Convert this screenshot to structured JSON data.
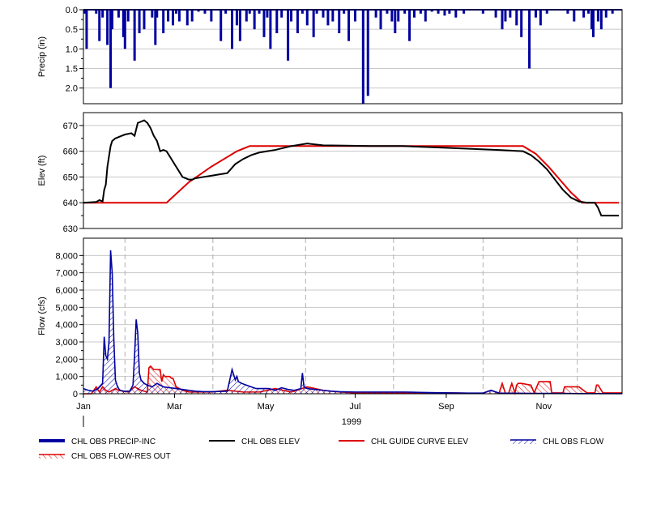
{
  "chart_data": [
    {
      "type": "bar",
      "panel": "precip",
      "ylabel": "Precip (in)",
      "ylim": [
        0,
        2.4
      ],
      "y_inverted": true,
      "yticks": [
        "0.0",
        "0.5",
        "1.0",
        "1.5",
        "2.0"
      ],
      "ytick_values": [
        0,
        0.5,
        1.0,
        1.5,
        2.0
      ],
      "grid": true,
      "series": [
        {
          "name": "CHL OBS PRECIP-INC",
          "color": "#0000a0",
          "x": [
            1,
            2,
            8,
            10,
            12,
            15,
            17,
            18,
            22,
            25,
            26,
            28,
            32,
            35,
            38,
            43,
            45,
            46,
            50,
            53,
            56,
            58,
            60,
            65,
            68,
            72,
            76,
            80,
            86,
            89,
            93,
            96,
            98,
            102,
            104,
            107,
            110,
            113,
            115,
            117,
            121,
            124,
            128,
            130,
            134,
            137,
            140,
            144,
            146,
            150,
            153,
            156,
            160,
            163,
            166,
            170,
            175,
            178,
            183,
            186,
            190,
            193,
            195,
            197,
            201,
            204,
            207,
            211,
            214,
            218,
            222,
            226,
            229,
            233,
            238,
            250,
            258,
            262,
            264,
            267,
            271,
            274,
            279,
            283,
            286,
            290,
            303,
            307,
            313,
            316,
            318,
            319,
            322,
            324,
            327,
            331
          ],
          "values": [
            0.1,
            1.0,
            0.1,
            0.8,
            0.2,
            0.9,
            2.0,
            0.5,
            0.2,
            0.7,
            1.0,
            0.3,
            1.3,
            0.6,
            0.5,
            0.2,
            0.9,
            0.2,
            0.6,
            0.3,
            0.4,
            0.1,
            0.3,
            0.4,
            0.3,
            0.05,
            0.1,
            0.3,
            0.8,
            0.1,
            1.0,
            0.4,
            0.8,
            0.3,
            0.1,
            0.5,
            0.1,
            0.7,
            0.2,
            1.0,
            0.6,
            0.2,
            1.3,
            0.3,
            0.6,
            0.1,
            0.4,
            0.7,
            0.1,
            0.2,
            0.4,
            0.3,
            0.6,
            0.1,
            0.8,
            0.3,
            2.4,
            2.2,
            0.2,
            0.5,
            0.1,
            0.3,
            0.6,
            0.3,
            0.1,
            0.8,
            0.2,
            0.1,
            0.3,
            0.05,
            0.1,
            0.15,
            0.1,
            0.2,
            0.1,
            0.1,
            0.2,
            0.5,
            0.3,
            0.2,
            0.4,
            0.7,
            1.5,
            0.2,
            0.4,
            0.1,
            0.1,
            0.3,
            0.2,
            0.1,
            0.5,
            0.7,
            0.3,
            0.5,
            0.2,
            0.1
          ]
        }
      ]
    },
    {
      "type": "line",
      "panel": "elevation",
      "ylabel": "Elev (ft)",
      "ylim": [
        630,
        675
      ],
      "yticks": [
        "630",
        "640",
        "650",
        "660",
        "670"
      ],
      "ytick_values": [
        630,
        640,
        650,
        660,
        670
      ],
      "grid": true,
      "series": [
        {
          "name": "CHL OBS ELEV",
          "color": "#000000",
          "x": [
            0,
            8,
            10,
            12,
            13,
            14,
            15,
            16,
            17,
            18,
            19,
            20,
            22,
            24,
            26,
            30,
            32,
            34,
            36,
            38,
            40,
            42,
            44,
            46,
            48,
            50,
            52,
            54,
            56,
            58,
            60,
            62,
            64,
            66,
            68,
            70,
            75,
            80,
            85,
            90,
            95,
            100,
            105,
            110,
            115,
            120,
            130,
            140,
            150,
            160,
            180,
            200,
            220,
            240,
            260,
            275,
            280,
            285,
            290,
            295,
            300,
            305,
            310,
            315,
            320,
            322,
            324,
            330,
            335
          ],
          "values": [
            640,
            640.3,
            641,
            640.5,
            645,
            647,
            654,
            658,
            662,
            664,
            664.5,
            665,
            665.5,
            666,
            666.5,
            667,
            666,
            671,
            671.5,
            672,
            671,
            669,
            666,
            664,
            660,
            660.5,
            660,
            658,
            656,
            654,
            652,
            650,
            649.5,
            649,
            649,
            649.5,
            650,
            650.5,
            651,
            651.5,
            655,
            657,
            658.5,
            659.5,
            660,
            660.5,
            662,
            663,
            662.3,
            662.2,
            662,
            662,
            661.5,
            661,
            660.5,
            660,
            658.5,
            656,
            653,
            649,
            645,
            642,
            640.5,
            640,
            640,
            638,
            635,
            635,
            635
          ]
        },
        {
          "name": "CHL GUIDE CURVE ELEV",
          "color": "#dd0000",
          "x": [
            0,
            52,
            59,
            66,
            73,
            80,
            88,
            96,
            104,
            110,
            116,
            275,
            283,
            291,
            298,
            305,
            312,
            335
          ],
          "values": [
            640,
            640,
            644,
            648,
            651,
            654,
            657,
            660,
            662,
            662,
            662,
            662,
            659,
            654,
            649,
            644,
            640,
            640
          ]
        }
      ]
    },
    {
      "type": "line",
      "panel": "flow",
      "xlabel": "1999",
      "ylabel": "Flow (cfs)",
      "ylim": [
        0,
        9000
      ],
      "yticks": [
        "0",
        "1,000",
        "2,000",
        "3,000",
        "4,000",
        "5,000",
        "6,000",
        "7,000",
        "8,000"
      ],
      "ytick_values": [
        0,
        1000,
        2000,
        3000,
        4000,
        5000,
        6000,
        7000,
        8000
      ],
      "xticks": [
        "Jan",
        "Mar",
        "May",
        "Jul",
        "Sep",
        "Nov"
      ],
      "xtick_values": [
        0,
        57,
        114,
        170,
        227,
        288
      ],
      "x_dashed_gridlines": [
        26,
        81,
        139,
        194,
        250,
        309
      ],
      "xlim": [
        0,
        337
      ],
      "grid": true,
      "series": [
        {
          "name": "CHL OBS FLOW",
          "color": "#0000a0",
          "hatched": true,
          "x": [
            0,
            3,
            6,
            9,
            12,
            13,
            14,
            15,
            16,
            17,
            18,
            19,
            20,
            21,
            22,
            23,
            25,
            27,
            29,
            31,
            32,
            33,
            34,
            35,
            36,
            38,
            40,
            43,
            46,
            50,
            54,
            58,
            62,
            66,
            70,
            75,
            80,
            85,
            90,
            93,
            95,
            96,
            97,
            99,
            102,
            105,
            108,
            112,
            116,
            120,
            124,
            128,
            132,
            136,
            137,
            138,
            140,
            145,
            150,
            155,
            160,
            170,
            180,
            190,
            200,
            210,
            220,
            230,
            240,
            250,
            255,
            260,
            265,
            270,
            280,
            290,
            300,
            310,
            315,
            320,
            325,
            330,
            337
          ],
          "values": [
            300,
            200,
            150,
            300,
            600,
            3300,
            2200,
            2000,
            3000,
            8300,
            7000,
            3200,
            800,
            500,
            300,
            200,
            150,
            150,
            150,
            500,
            2200,
            4300,
            3500,
            1200,
            800,
            600,
            500,
            400,
            600,
            400,
            350,
            300,
            250,
            200,
            150,
            120,
            120,
            130,
            150,
            1400,
            800,
            1000,
            700,
            600,
            500,
            400,
            300,
            300,
            300,
            200,
            350,
            250,
            200,
            300,
            1200,
            400,
            300,
            250,
            200,
            150,
            120,
            100,
            100,
            100,
            100,
            80,
            60,
            50,
            40,
            40,
            200,
            40,
            30,
            30,
            20,
            20,
            20,
            10,
            10,
            10,
            10,
            10,
            10
          ]
        },
        {
          "name": "CHL OBS FLOW-RES OUT",
          "color": "#dd0000",
          "hatched": true,
          "x": [
            0,
            5,
            8,
            10,
            12,
            14,
            16,
            18,
            20,
            22,
            25,
            28,
            32,
            36,
            40,
            41,
            42,
            43,
            44,
            48,
            49,
            50,
            51,
            52,
            54,
            55,
            56,
            58,
            60,
            62,
            64,
            66,
            70,
            75,
            80,
            90,
            100,
            110,
            120,
            130,
            140,
            150,
            160,
            170,
            180,
            190,
            200,
            210,
            220,
            230,
            240,
            250,
            255,
            260,
            262,
            264,
            266,
            268,
            270,
            271,
            272,
            273,
            274,
            280,
            282,
            285,
            290,
            292,
            293,
            300,
            301,
            310,
            315,
            320,
            321,
            322,
            325,
            326,
            330,
            337
          ],
          "values": [
            0,
            0,
            400,
            100,
            400,
            200,
            100,
            200,
            300,
            200,
            150,
            100,
            400,
            200,
            100,
            1500,
            1600,
            1500,
            1400,
            1400,
            700,
            1100,
            1000,
            1000,
            1000,
            900,
            900,
            400,
            300,
            200,
            150,
            100,
            100,
            100,
            100,
            200,
            100,
            100,
            300,
            100,
            400,
            200,
            100,
            50,
            50,
            50,
            50,
            50,
            50,
            50,
            30,
            30,
            200,
            30,
            600,
            30,
            30,
            600,
            50,
            500,
            600,
            600,
            600,
            500,
            50,
            700,
            700,
            700,
            50,
            50,
            400,
            400,
            50,
            50,
            500,
            500,
            50,
            50,
            50,
            50
          ]
        }
      ]
    }
  ],
  "legend": [
    {
      "label": "CHL OBS PRECIP-INC",
      "style": "thick-line",
      "color": "#0000a0"
    },
    {
      "label": "CHL OBS ELEV",
      "style": "line",
      "color": "#000000"
    },
    {
      "label": "CHL GUIDE CURVE ELEV",
      "style": "line",
      "color": "#dd0000"
    },
    {
      "label": "CHL OBS FLOW",
      "style": "hatched-line",
      "color": "#0000a0"
    },
    {
      "label": "CHL OBS FLOW-RES OUT",
      "style": "hatched-line",
      "color": "#dd0000"
    }
  ],
  "x_axis": {
    "year_label": "1999",
    "month_labels": [
      "Jan",
      "Mar",
      "May",
      "Jul",
      "Sep",
      "Nov"
    ]
  }
}
